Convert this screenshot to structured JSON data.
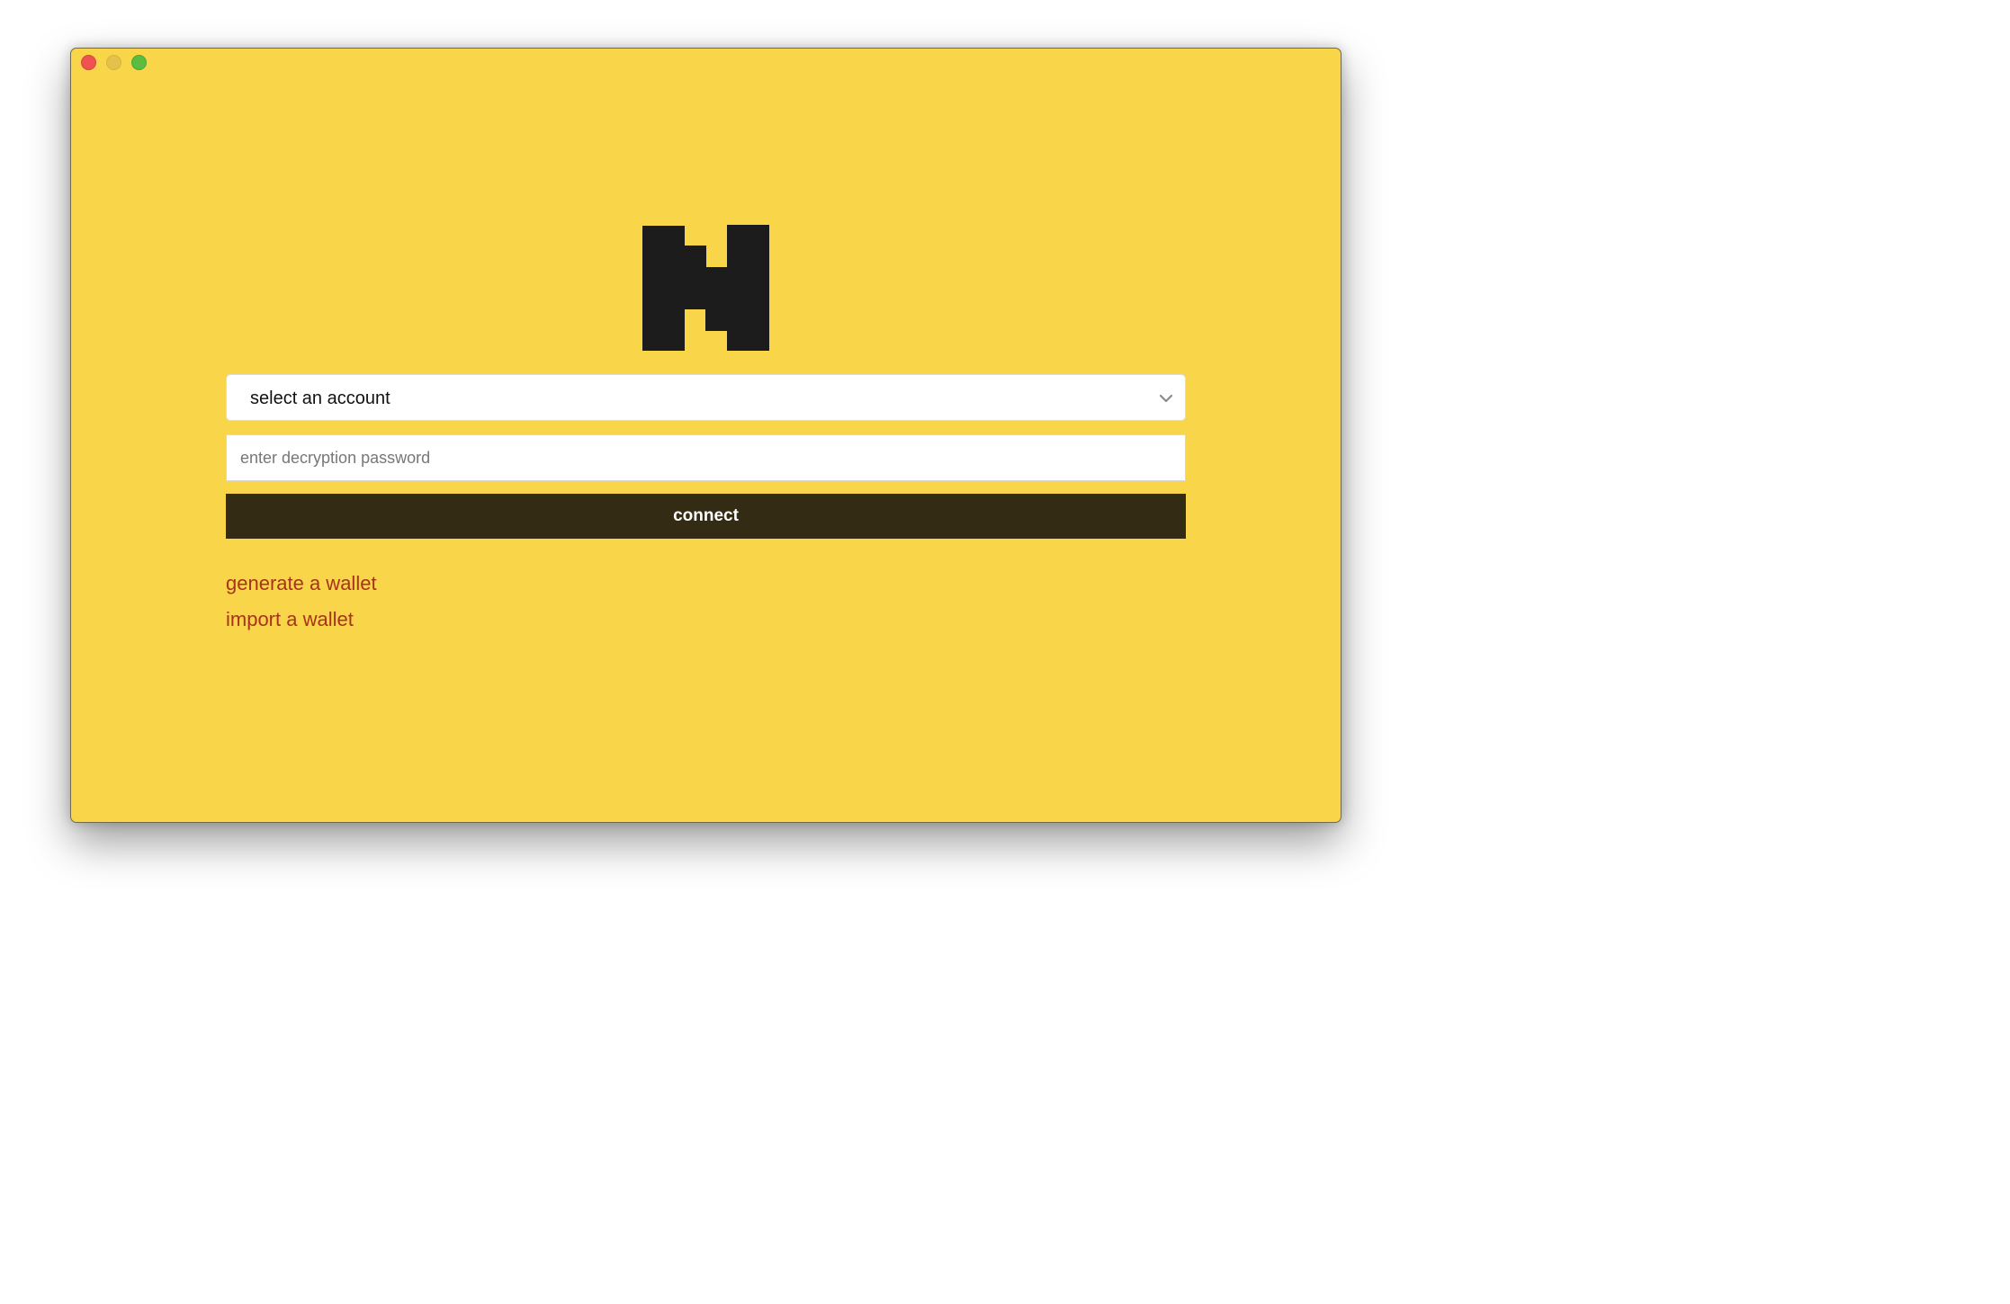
{
  "window": {
    "traffic_lights": [
      "close",
      "minimize",
      "maximize"
    ]
  },
  "logo": {
    "icon": "h-logo-icon"
  },
  "account_select": {
    "value": "select an account",
    "icon": "chevron-down-icon"
  },
  "password": {
    "placeholder": "enter decryption password",
    "value": ""
  },
  "connect_button": {
    "label": "connect"
  },
  "links": {
    "generate": "generate a wallet",
    "import": "import a wallet"
  },
  "colors": {
    "background": "#f9d649",
    "button": "#332b13",
    "link": "#a8321d",
    "logo": "#1c1c1c"
  }
}
